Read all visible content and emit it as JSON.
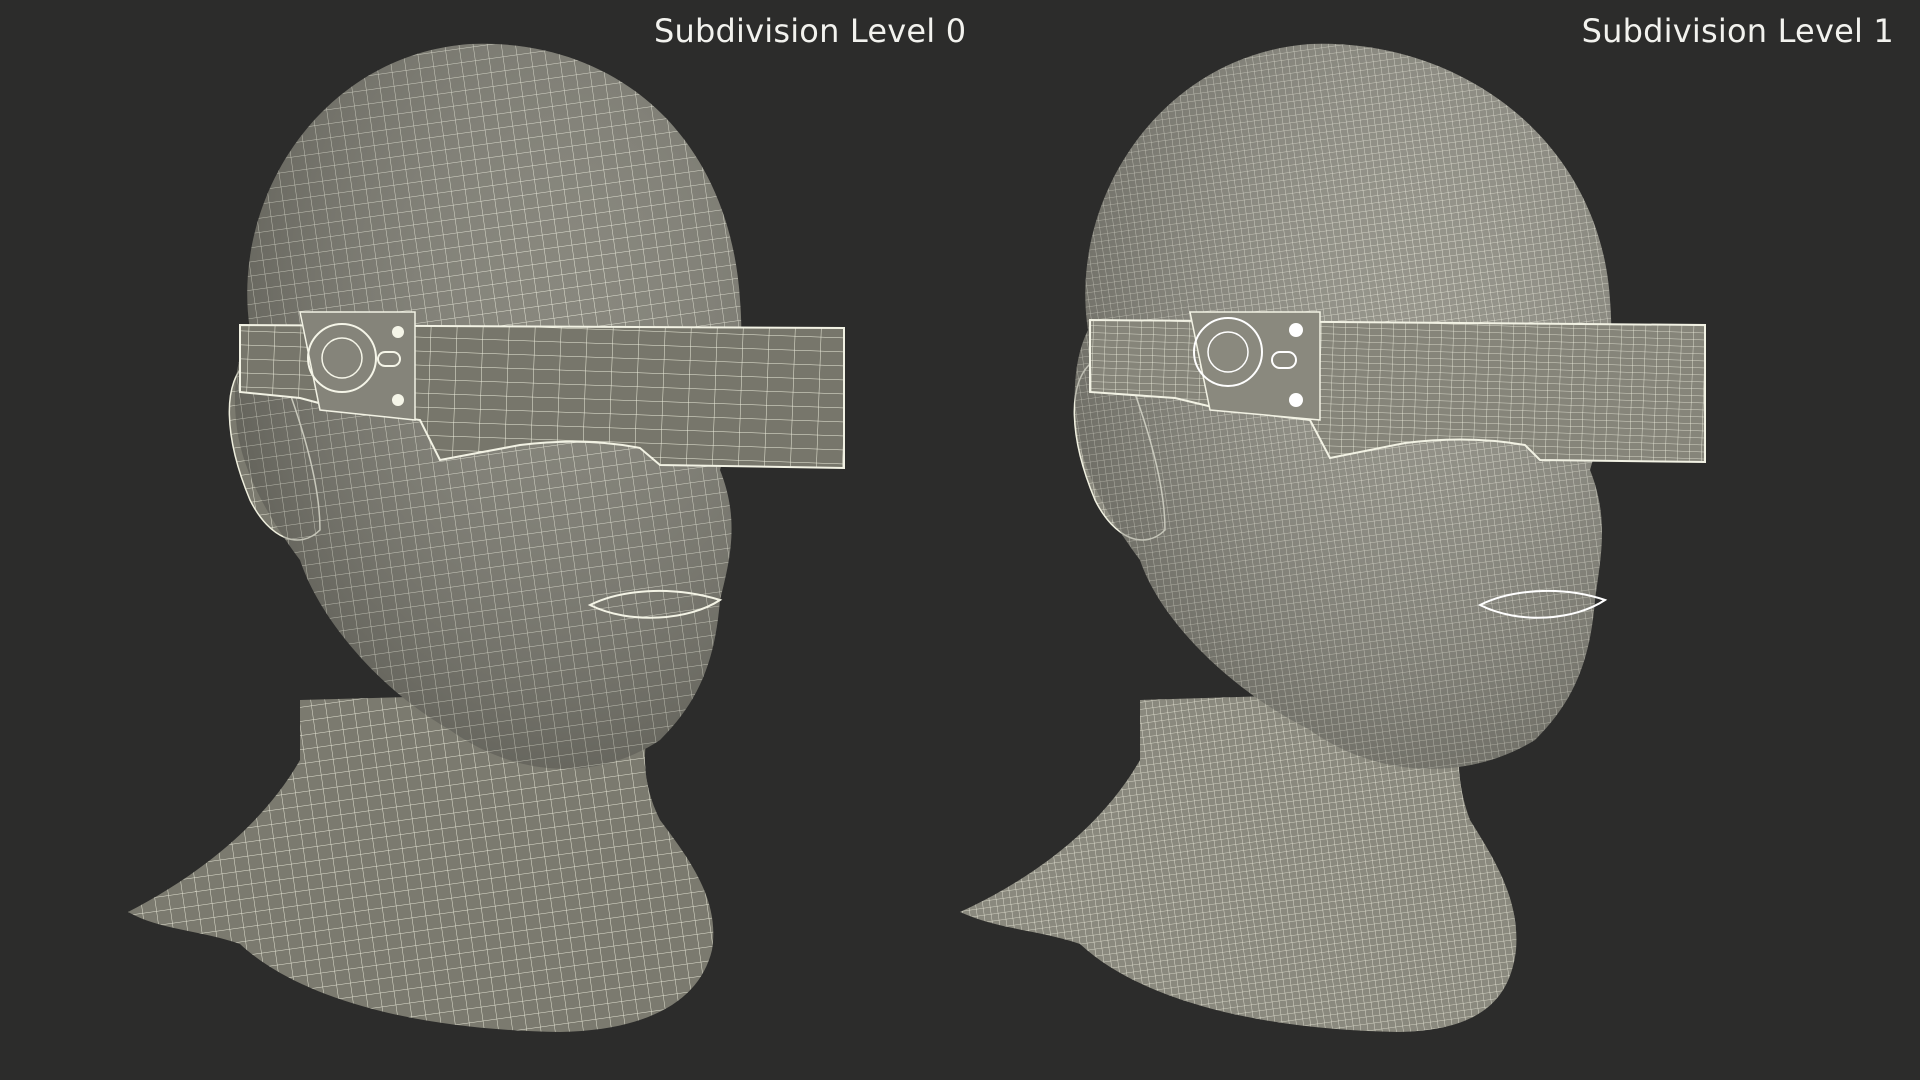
{
  "labels": {
    "left": "Subdivision Level 0",
    "right": "Subdivision Level 1"
  },
  "colors": {
    "background": "#2c2c2b",
    "mesh_fill": "#7b7a6f",
    "wire": "#eeeedd",
    "text": "#f2f2ee"
  },
  "renders": [
    {
      "name": "head-with-visor-level-0",
      "density": "coarse"
    },
    {
      "name": "head-with-visor-level-1",
      "density": "fine"
    }
  ]
}
